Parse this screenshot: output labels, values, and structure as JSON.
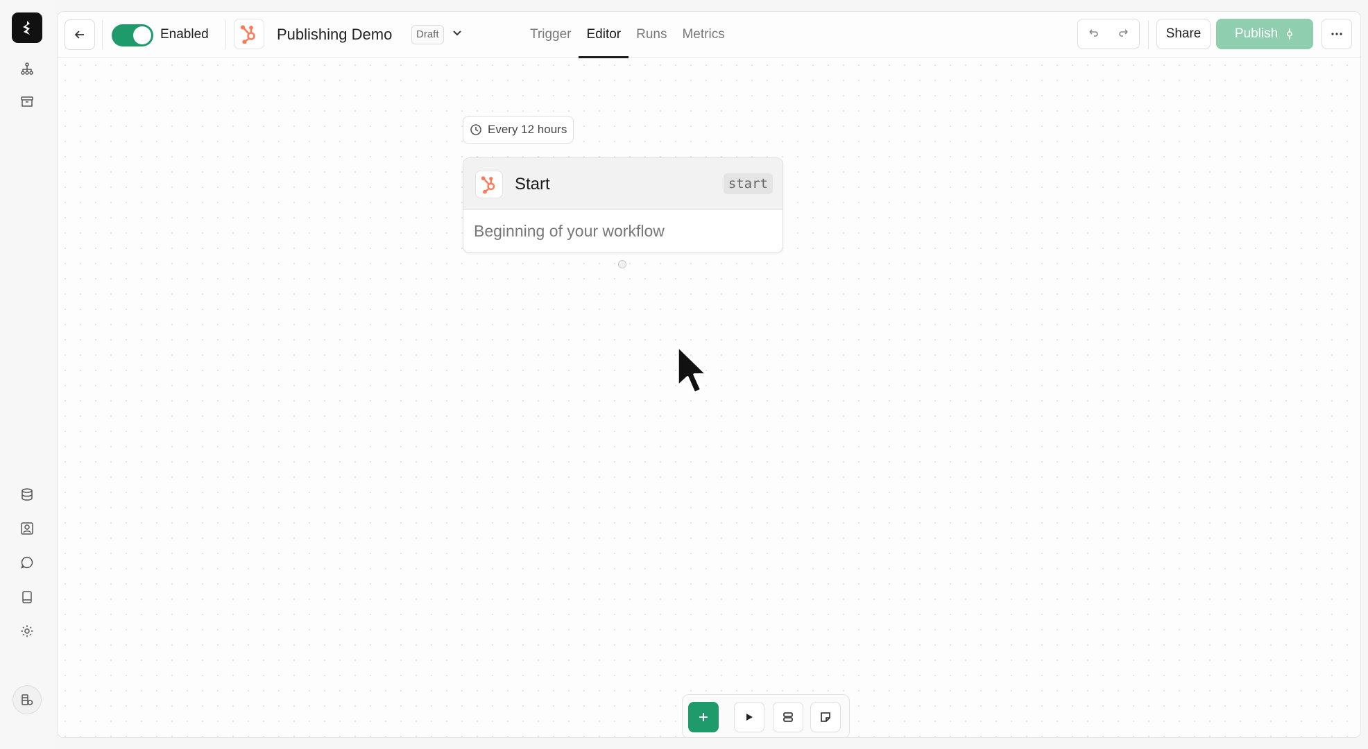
{
  "header": {
    "enabled_label": "Enabled",
    "workflow_title": "Publishing Demo",
    "status_badge": "Draft",
    "tabs": [
      {
        "label": "Trigger",
        "active": false
      },
      {
        "label": "Editor",
        "active": true
      },
      {
        "label": "Runs",
        "active": false
      },
      {
        "label": "Metrics",
        "active": false
      }
    ],
    "share_label": "Share",
    "publish_label": "Publish",
    "toggle_on": true
  },
  "node": {
    "schedule": "Every 12 hours",
    "title": "Start",
    "slug": "start",
    "description": "Beginning of your workflow"
  },
  "icons": {
    "rail_top": [
      "workflow-tree-icon",
      "archive-icon"
    ],
    "rail_bottom": [
      "database-icon",
      "contact-icon",
      "chat-icon",
      "book-icon",
      "settings-icon"
    ],
    "bottom_tools": [
      "plus-icon",
      "play-icon",
      "layers-icon",
      "sticky-note-icon"
    ]
  },
  "colors": {
    "accent": "#1f9a6a",
    "publish_disabled": "#8fcfb0",
    "hubspot": "#ff7a59"
  }
}
